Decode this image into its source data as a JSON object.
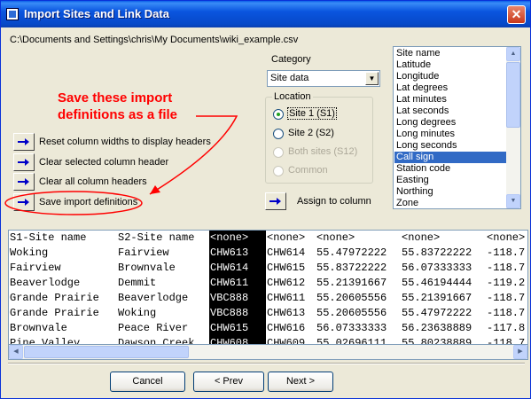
{
  "window": {
    "title": "Import Sites and Link Data"
  },
  "file_path": "C:\\Documents and Settings\\chris\\My Documents\\wiki_example.csv",
  "category": {
    "label": "Category",
    "selected": "Site data"
  },
  "location": {
    "legend": "Location",
    "options": [
      {
        "label": "Site 1 (S1)",
        "checked": true,
        "disabled": false
      },
      {
        "label": "Site 2 (S2)",
        "checked": false,
        "disabled": false
      },
      {
        "label": "Both sites (S12)",
        "checked": false,
        "disabled": true
      },
      {
        "label": "Common",
        "checked": false,
        "disabled": true
      }
    ]
  },
  "assign": {
    "label": "Assign to column"
  },
  "fields": {
    "items": [
      "Site name",
      "Latitude",
      "Longitude",
      "Lat degrees",
      "Lat minutes",
      "Lat seconds",
      "Long degrees",
      "Long minutes",
      "Long seconds",
      "Call sign",
      "Station code",
      "Easting",
      "Northing",
      "Zone"
    ],
    "selected": "Call sign"
  },
  "actions": [
    "Reset column widths to display headers",
    "Clear selected column header",
    "Clear all column headers",
    "Save import definitions"
  ],
  "annotation": {
    "line1": "Save these import",
    "line2": "definitions as a file"
  },
  "grid": {
    "columns": [
      {
        "header": "S1-Site name",
        "cells": [
          "Woking",
          "Fairview",
          "Beaverlodge",
          "Grande Prairie",
          "Grande Prairie",
          "Brownvale",
          "Pine Valley"
        ]
      },
      {
        "header": "S2-Site name",
        "cells": [
          "Fairview",
          "Brownvale",
          "Demmit",
          "Beaverlodge",
          "Woking",
          "Peace River",
          "Dawson Creek"
        ]
      },
      {
        "header": "<none>",
        "cells": [
          "CHW613",
          "CHW614",
          "CHW611",
          "VBC888",
          "VBC888",
          "CHW615",
          "CHW608"
        ],
        "selected": true
      },
      {
        "header": "<none>",
        "cells": [
          "CHW614",
          "CHW615",
          "CHW612",
          "CHW611",
          "CHW613",
          "CHW616",
          "CHW609"
        ]
      },
      {
        "header": "<none>",
        "cells": [
          "55.47972222",
          "55.83722222",
          "55.21391667",
          "55.20605556",
          "55.20605556",
          "56.07333333",
          "55.02696111"
        ]
      },
      {
        "header": "<none>",
        "cells": [
          "55.83722222",
          "56.07333333",
          "55.46194444",
          "55.21391667",
          "55.47972222",
          "56.23638889",
          "55.80238889"
        ]
      },
      {
        "header": "<none>",
        "cells": [
          "-118.7",
          "-118.7",
          "-119.2",
          "-118.7",
          "-118.7",
          "-117.8",
          "-118.7"
        ]
      }
    ]
  },
  "buttons": {
    "cancel": "Cancel",
    "prev": "< Prev",
    "next": "Next >"
  },
  "colors": {
    "accent": "#316AC5",
    "annotation": "#FF0000",
    "titlebar": "#0A55DF"
  }
}
